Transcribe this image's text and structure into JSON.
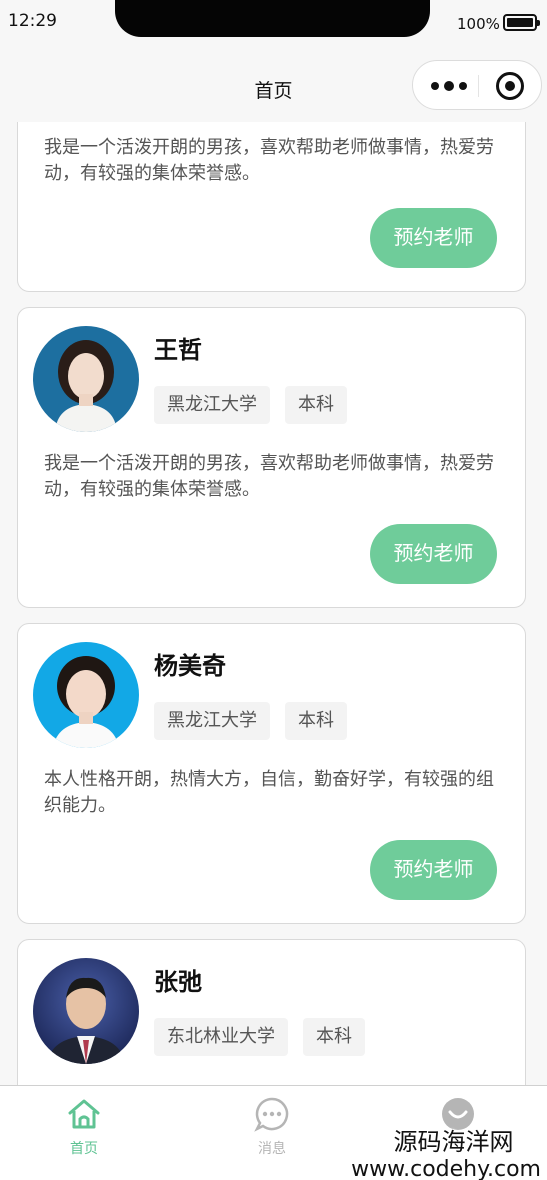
{
  "status_bar": {
    "time": "12:29",
    "battery": "100%"
  },
  "nav": {
    "title": "首页"
  },
  "cards": [
    {
      "name": "",
      "tags": [],
      "bio": "我是一个活泼开朗的男孩，喜欢帮助老师做事情，热爱劳动，有较强的集体荣誉感。",
      "button": "预约老师"
    },
    {
      "name": "王哲",
      "tags": [
        "黑龙江大学",
        "本科"
      ],
      "bio": "我是一个活泼开朗的男孩，喜欢帮助老师做事情，热爱劳动，有较强的集体荣誉感。",
      "button": "预约老师"
    },
    {
      "name": "杨美奇",
      "tags": [
        "黑龙江大学",
        "本科"
      ],
      "bio": "本人性格开朗，热情大方，自信，勤奋好学，有较强的组织能力。",
      "button": "预约老师"
    },
    {
      "name": "张弛",
      "tags": [
        "东北林业大学",
        "本科"
      ],
      "bio": "",
      "button": ""
    }
  ],
  "tabbar": {
    "items": [
      {
        "label": "首页",
        "icon": "home-icon",
        "active": true
      },
      {
        "label": "消息",
        "icon": "message-icon",
        "active": false
      },
      {
        "label": "",
        "icon": "profile-icon",
        "active": false
      }
    ]
  },
  "watermark": {
    "name": "源码海洋网",
    "url": "www.codehy.com"
  },
  "colors": {
    "accent": "#6fcc9a",
    "tab_active": "#5fc393",
    "tag_bg": "#f3f3f3"
  }
}
